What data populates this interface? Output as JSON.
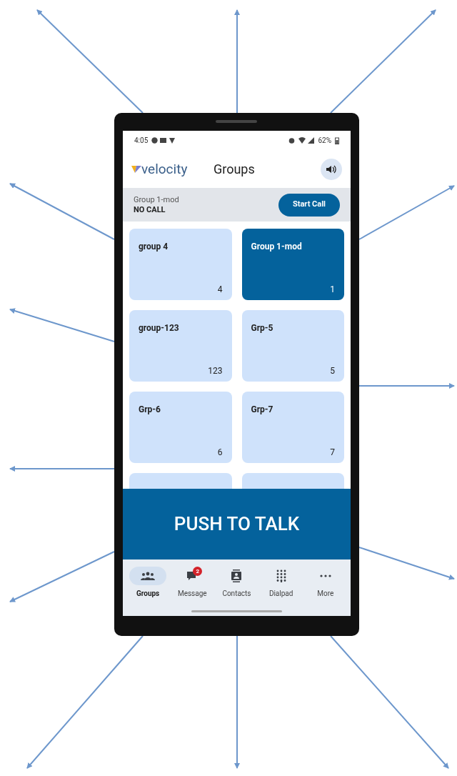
{
  "status_bar": {
    "time": "4:05",
    "battery": "62%"
  },
  "header": {
    "logo": "velocity",
    "title": "Groups"
  },
  "current_group": {
    "name": "Group 1-mod",
    "state": "NO CALL",
    "action": "Start Call"
  },
  "groups": [
    {
      "name": "group 4",
      "count": "4",
      "selected": false
    },
    {
      "name": "Group 1-mod",
      "count": "1",
      "selected": true
    },
    {
      "name": "group-123",
      "count": "123",
      "selected": false
    },
    {
      "name": "Grp-5",
      "count": "5",
      "selected": false
    },
    {
      "name": "Grp-6",
      "count": "6",
      "selected": false
    },
    {
      "name": "Grp-7",
      "count": "7",
      "selected": false
    },
    {
      "selected": false
    },
    {
      "selected": false
    }
  ],
  "push_to_talk": "PUSH TO TALK",
  "nav": [
    {
      "kind": "groups",
      "label": "Groups",
      "selected": true
    },
    {
      "kind": "message",
      "label": "Message",
      "selected": false,
      "badge": "2"
    },
    {
      "kind": "contacts",
      "label": "Contacts",
      "selected": false
    },
    {
      "kind": "dialpad",
      "label": "Dialpad",
      "selected": false
    },
    {
      "kind": "more",
      "label": "More",
      "selected": false
    }
  ]
}
